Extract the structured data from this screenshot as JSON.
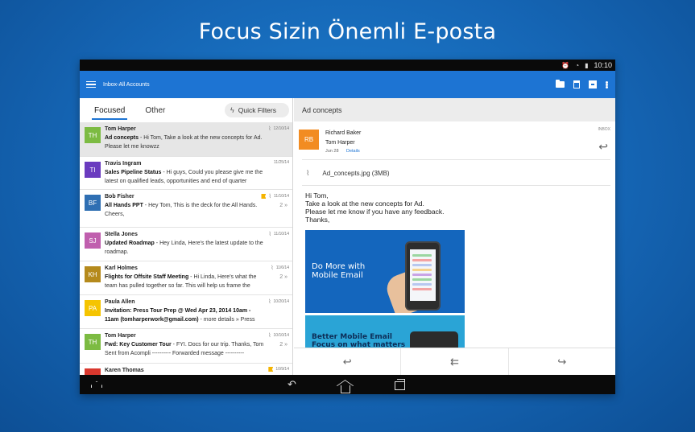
{
  "headline": "Focus Sizin Önemli E-posta",
  "status_bar": {
    "time": "10:10",
    "icons": [
      "alarm-icon",
      "wifi-icon",
      "battery-icon"
    ]
  },
  "app_bar": {
    "account": "Inbox-All Accounts",
    "actions": [
      "folder-icon",
      "trash-icon",
      "archive-icon",
      "more-icon"
    ]
  },
  "tabs": {
    "focused": "Focused",
    "other": "Other",
    "quick_filters": "Quick Filters"
  },
  "messages": [
    {
      "initials": "TH",
      "avatar_color": "#7cbb42",
      "sender": "Tom Harper",
      "subject": "Ad concepts",
      "snippet": " - Hi Tom, Take a look at the new concepts for Ad. Please let me knowzz",
      "date": "12/10/14",
      "attachment": true,
      "flag": false,
      "thread_count": "",
      "selected": true
    },
    {
      "initials": "TI",
      "avatar_color": "#6a3bbf",
      "sender": "Travis Ingram",
      "subject": "Sales Pipeline Status",
      "snippet": " - Hi guys, Could you please give me the latest on qualified leads, opportunities and end of quarter",
      "date": "11/25/14",
      "attachment": false,
      "flag": false,
      "thread_count": "",
      "selected": false
    },
    {
      "initials": "BF",
      "avatar_color": "#2f6fb3",
      "sender": "Bob Fisher",
      "subject": "All Hands PPT",
      "snippet": " - Hey Tom, This is the deck for the All Hands. Cheers,",
      "date": "11/10/14",
      "attachment": true,
      "flag": true,
      "thread_count": "2",
      "selected": false
    },
    {
      "initials": "SJ",
      "avatar_color": "#c05fae",
      "sender": "Stella Jones",
      "subject": "Updated Roadmap",
      "snippet": " - Hey Linda, Here's the latest update to the roadmap.",
      "date": "11/10/14",
      "attachment": true,
      "flag": false,
      "thread_count": "",
      "selected": false
    },
    {
      "initials": "KH",
      "avatar_color": "#b58a1c",
      "sender": "Karl Holmes",
      "subject": "Flights for Offsite Staff Meeting",
      "snippet": " - Hi Linda, Here's what the team has pulled together so far. This will help us frame the",
      "date": "11/6/14",
      "attachment": true,
      "flag": false,
      "thread_count": "2",
      "selected": false
    },
    {
      "initials": "PA",
      "avatar_color": "#f5c400",
      "sender": "Paula Allen",
      "subject": "Invitation: Press Tour Prep @ Wed Apr 23, 2014 10am - 11am (tomharperwork@gmail.com)",
      "snippet": " - more details » Press",
      "date": "10/20/14",
      "attachment": true,
      "flag": false,
      "thread_count": "",
      "selected": false
    },
    {
      "initials": "TH",
      "avatar_color": "#7cbb42",
      "sender": "Tom Harper",
      "subject": "Fwd: Key Customer Tour",
      "snippet": " - FYI. Docs for our trip. Thanks, Tom Sent from Acompli ---------- Forwarded message ----------",
      "date": "10/10/14",
      "attachment": true,
      "flag": false,
      "thread_count": "2",
      "selected": false
    },
    {
      "initials": "",
      "avatar_color": "#d9382e",
      "sender": "Karen Thomas",
      "subject": "",
      "snippet": "",
      "date": "10/9/14",
      "attachment": false,
      "flag": true,
      "thread_count": "",
      "selected": false
    }
  ],
  "reading": {
    "subject": "Ad concepts",
    "from_initials": "RB",
    "from_color": "#f28c22",
    "from": "Richard Baker",
    "to": "Tom Harper",
    "date": "Jun 28",
    "details_link": "Details",
    "folder_tag": "INBOX",
    "attachment_name": "Ad_concepts.jpg",
    "attachment_size": "(3MB)",
    "body_lines": [
      "Hi Tom,",
      "Take a look at the new concepts for Ad.",
      "Please let me know if you have any feedback.",
      "Thanks,"
    ],
    "promo1_lines": [
      "Do More with",
      "Mobile Email"
    ],
    "promo2_lines": [
      "Better Mobile Email",
      "Focus on what matters"
    ],
    "actions": [
      "reply-icon",
      "reply-all-icon",
      "forward-icon"
    ]
  },
  "nav": [
    "up-icon",
    "back-icon",
    "home-icon",
    "recent-apps-icon"
  ],
  "colors": {
    "accent": "#1d74d3",
    "background": "#1565b4"
  }
}
